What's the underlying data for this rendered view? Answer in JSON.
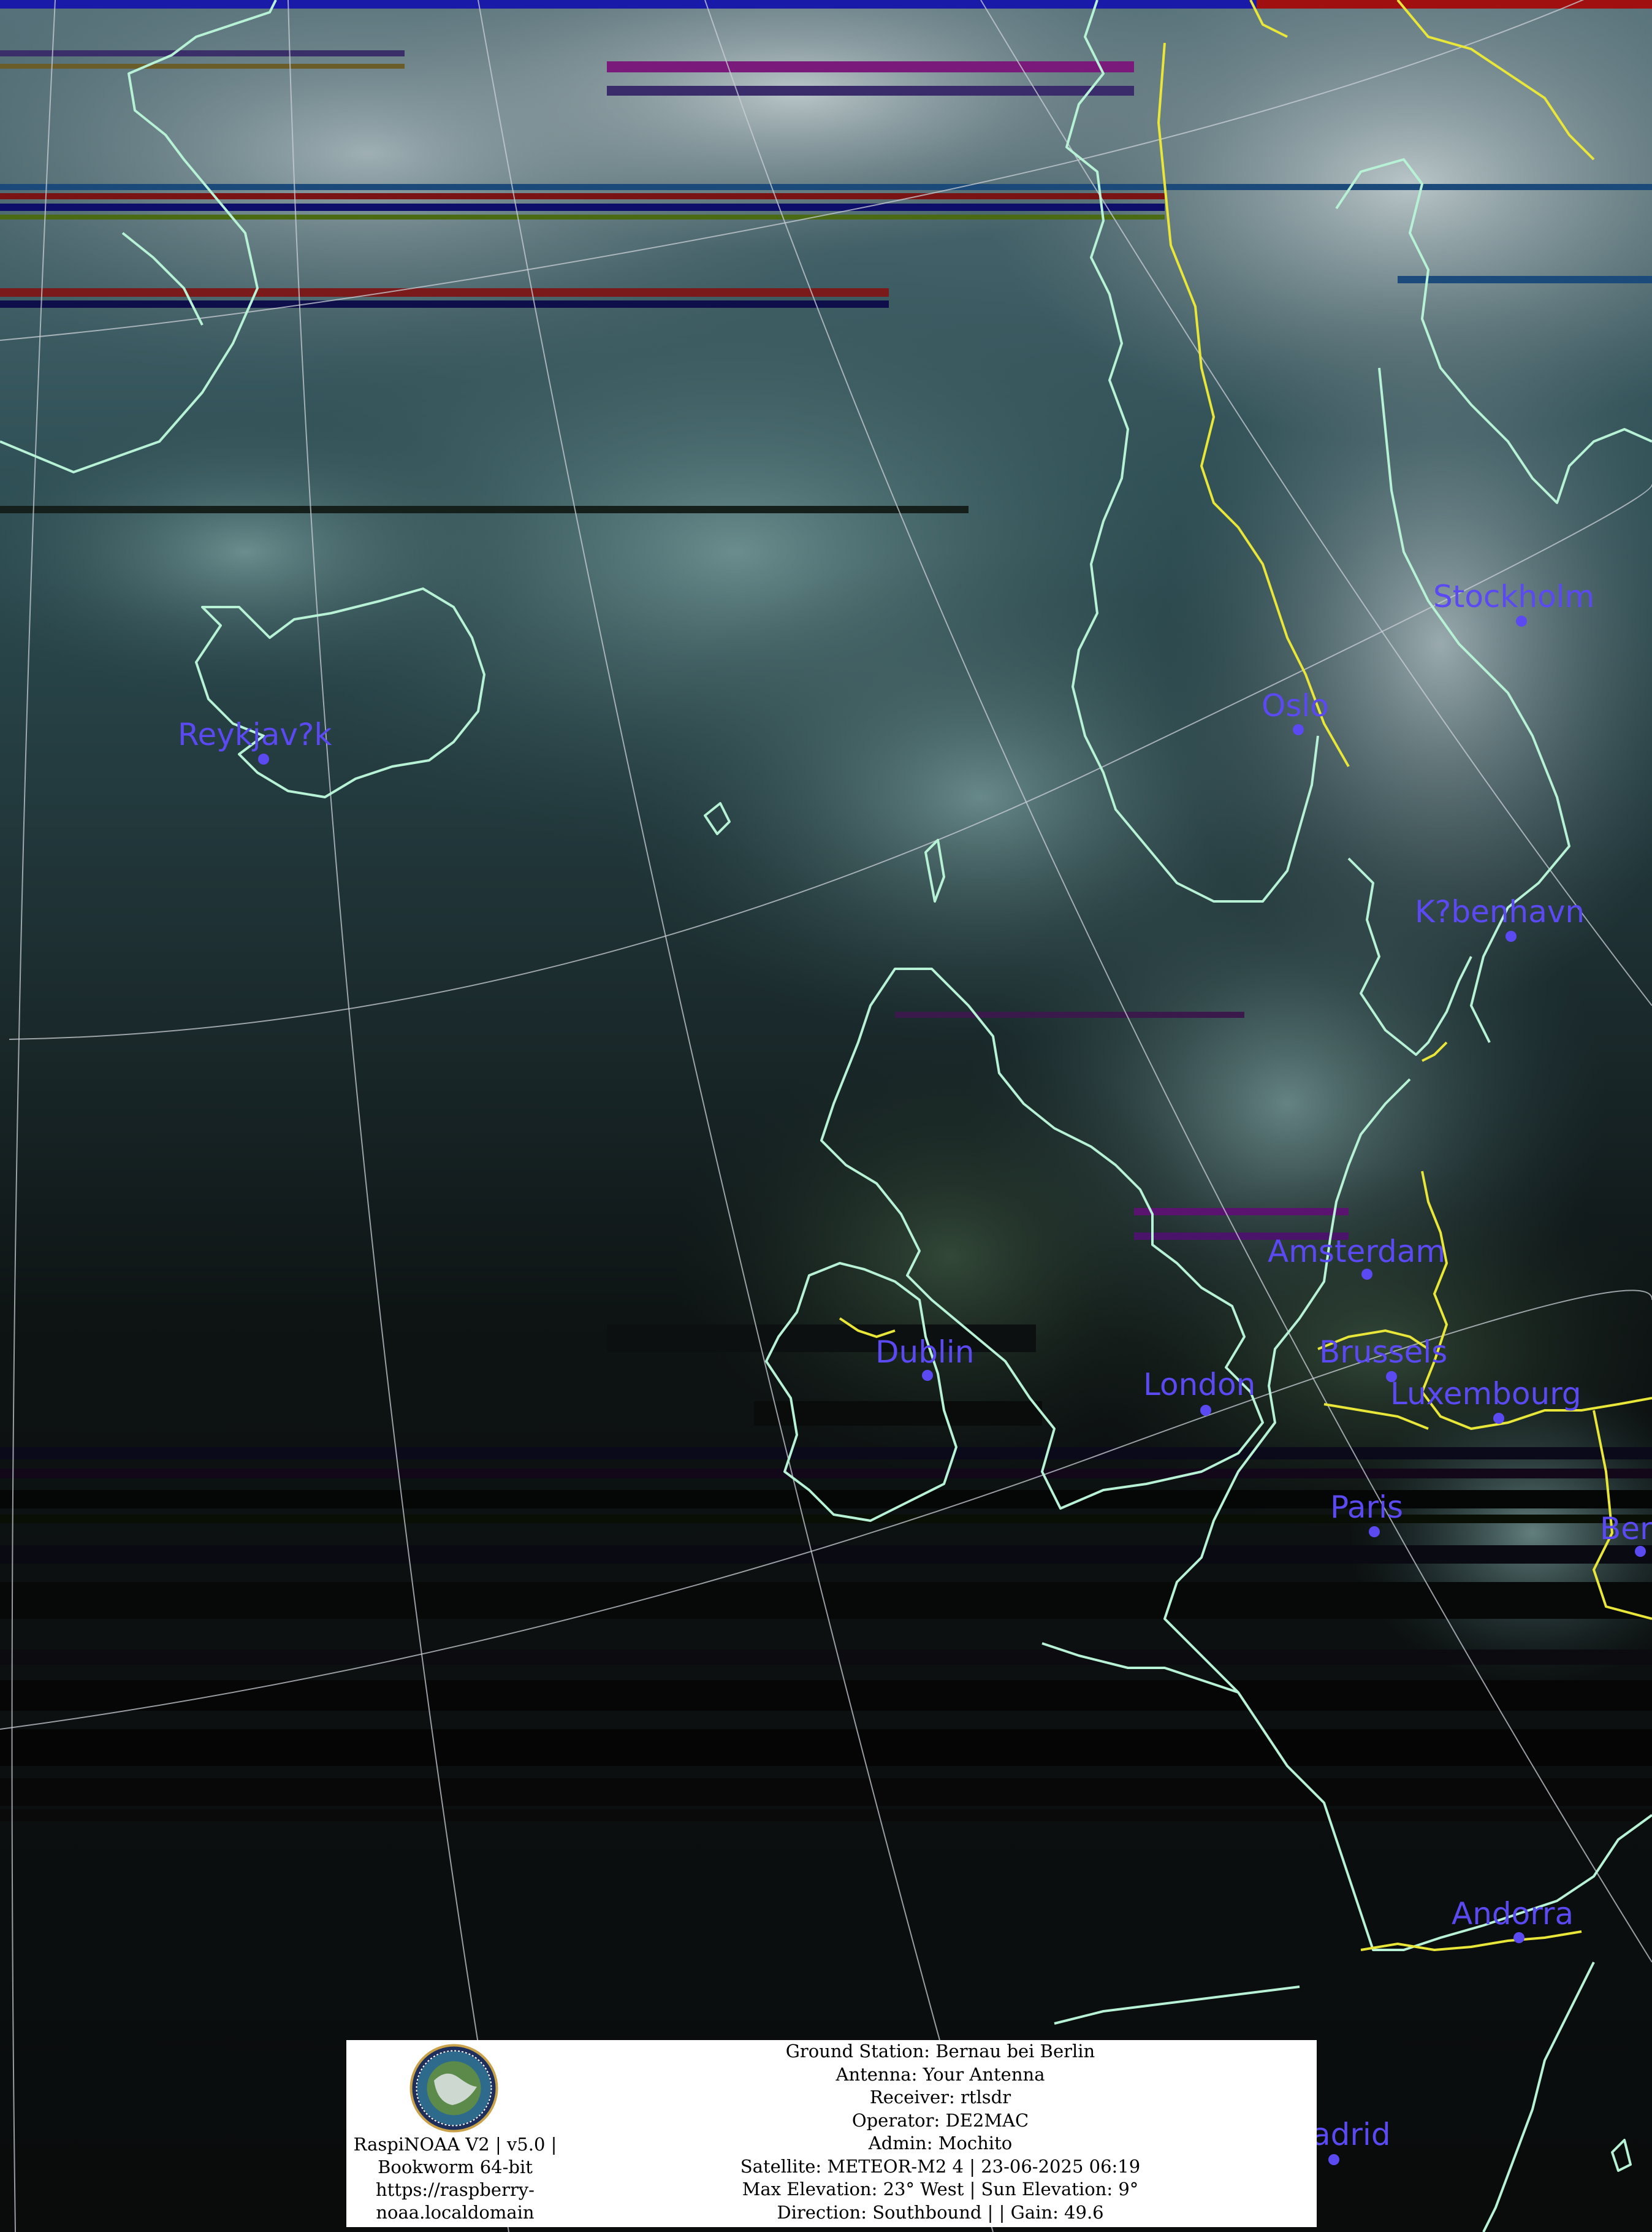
{
  "image": {
    "kind": "satellite-weather-image",
    "colors": {
      "coastline": "#b8f2d6",
      "border": "#e9e63a",
      "city_marker": "#5b49f2",
      "grid": "#c9cfd6"
    }
  },
  "cities": [
    {
      "name": "Stockholm"
    },
    {
      "name": "Oslo"
    },
    {
      "name": "Reykjav?k"
    },
    {
      "name": "K?benhavn"
    },
    {
      "name": "Amsterdam"
    },
    {
      "name": "Dublin"
    },
    {
      "name": "Brussels"
    },
    {
      "name": "London"
    },
    {
      "name": "Luxembourg"
    },
    {
      "name": "Paris"
    },
    {
      "name": "Ber"
    },
    {
      "name": "Andorra"
    },
    {
      "name": "adrid"
    }
  ],
  "footer": {
    "logo_icon": "raspinoaa-globe-logo",
    "logo_lines": [
      "RaspiNOAA V2 | v5.0 |",
      "Bookworm 64-bit",
      "https://raspberry-",
      "noaa.localdomain"
    ],
    "info_lines": [
      "Ground Station: Bernau bei Berlin",
      "Antenna: Your Antenna",
      "Receiver: rtlsdr",
      "Operator: DE2MAC",
      "Admin: Mochito",
      "Satellite: METEOR-M2 4 | 23-06-2025 06:19",
      "Max Elevation: 23° West | Sun Elevation: 9°",
      "Direction: Southbound | | Gain: 49.6"
    ]
  }
}
